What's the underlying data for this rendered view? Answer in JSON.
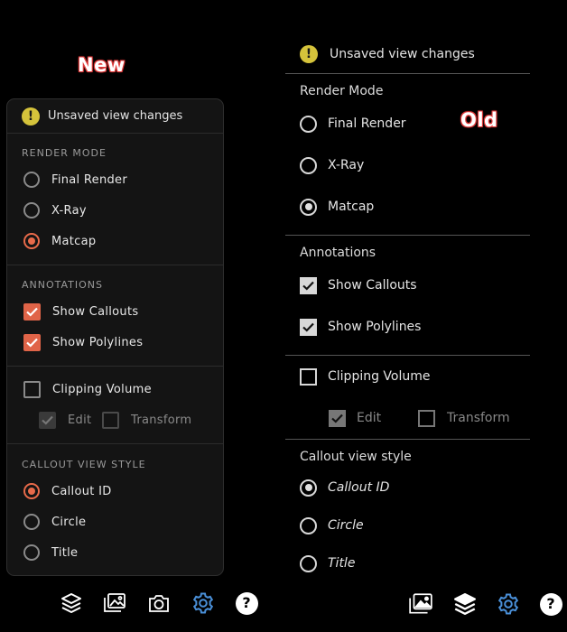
{
  "labels": {
    "new": "New",
    "old": "Old"
  },
  "colors": {
    "accent": "#e06448",
    "warning": "#d5c33b",
    "active_icon": "#4a90d9"
  },
  "new_panel": {
    "header": {
      "warning_glyph": "!",
      "text": "Unsaved view changes"
    },
    "render_mode": {
      "title": "RENDER MODE",
      "options": [
        "Final Render",
        "X-Ray",
        "Matcap"
      ],
      "selected": "Matcap"
    },
    "annotations": {
      "title": "ANNOTATIONS",
      "items": [
        {
          "label": "Show Callouts",
          "checked": true
        },
        {
          "label": "Show Polylines",
          "checked": true
        }
      ]
    },
    "clipping": {
      "label": "Clipping Volume",
      "checked": false,
      "edit": {
        "label": "Edit",
        "checked": true,
        "disabled": true
      },
      "transform": {
        "label": "Transform",
        "checked": false,
        "disabled": true
      }
    },
    "callout_style": {
      "title": "CALLOUT VIEW STYLE",
      "options": [
        "Callout ID",
        "Circle",
        "Title"
      ],
      "selected": "Callout ID"
    },
    "toolbar": [
      "layers-icon",
      "gallery-icon",
      "camera-icon",
      "gear-icon",
      "help-icon"
    ],
    "help_glyph": "?"
  },
  "old_panel": {
    "header": {
      "warning_glyph": "!",
      "text": "Unsaved view changes"
    },
    "render_mode": {
      "title": "Render Mode",
      "options": [
        "Final Render",
        "X-Ray",
        "Matcap"
      ],
      "selected": "Matcap"
    },
    "annotations": {
      "title": "Annotations",
      "items": [
        {
          "label": "Show Callouts",
          "checked": true
        },
        {
          "label": "Show Polylines",
          "checked": true
        }
      ]
    },
    "clipping": {
      "label": "Clipping Volume",
      "checked": false,
      "edit": {
        "label": "Edit",
        "checked": true,
        "disabled": true
      },
      "transform": {
        "label": "Transform",
        "checked": false,
        "disabled": true
      }
    },
    "callout_style": {
      "title": "Callout view style",
      "options": [
        "Callout ID",
        "Circle",
        "Title"
      ],
      "selected": "Callout ID"
    },
    "toolbar": [
      "gallery-icon",
      "layers-icon",
      "gear-icon",
      "help-icon"
    ],
    "help_glyph": "?"
  }
}
